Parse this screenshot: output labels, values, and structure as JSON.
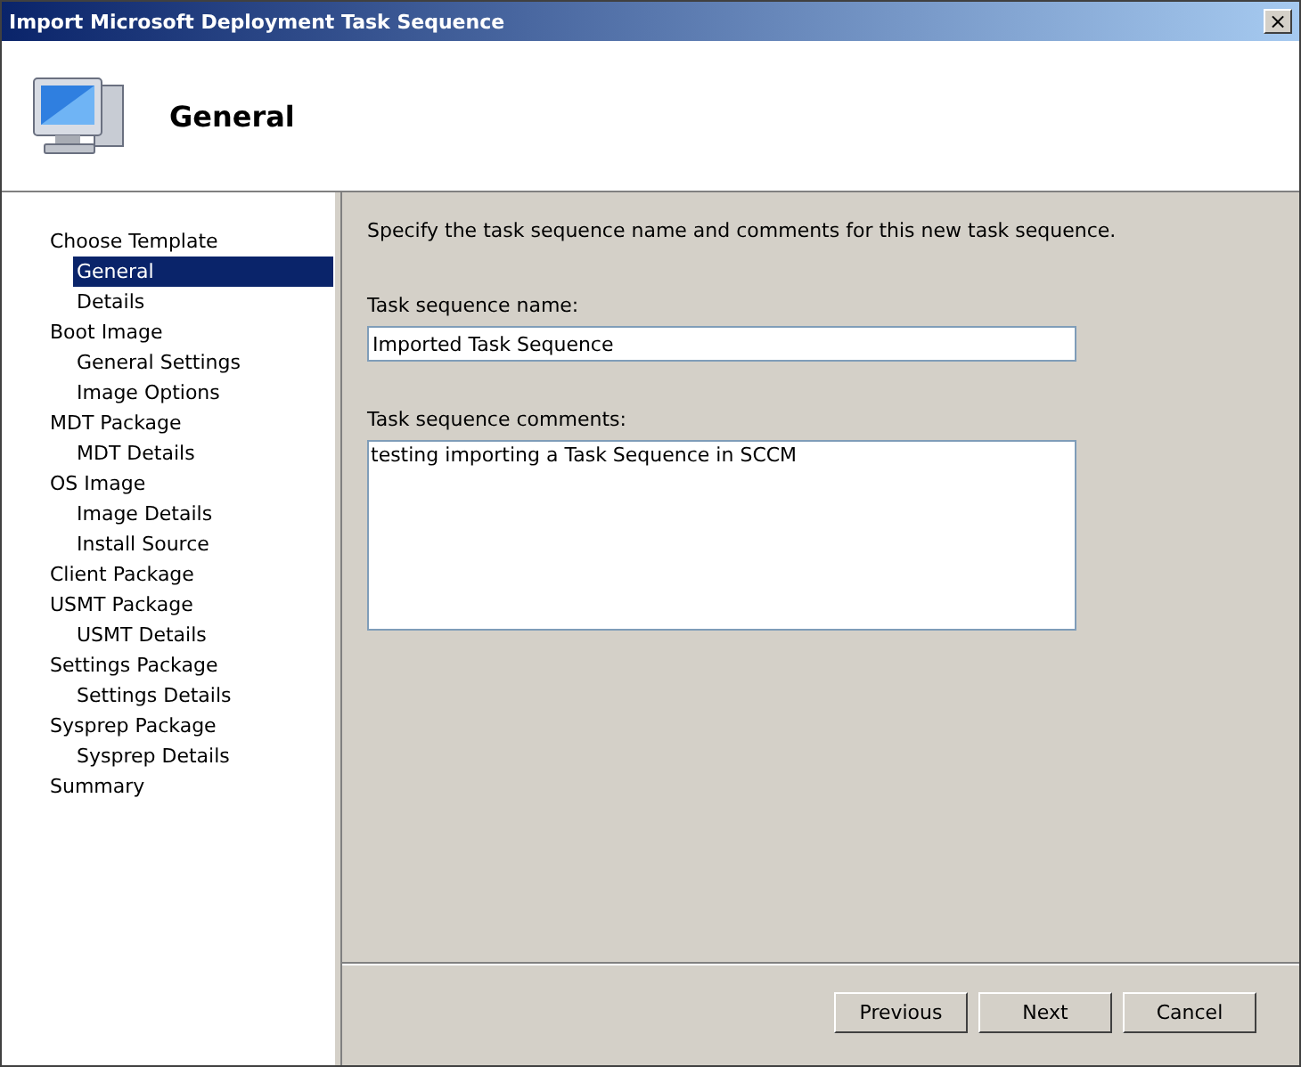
{
  "window": {
    "title": "Import Microsoft Deployment Task Sequence",
    "close": "×"
  },
  "header": {
    "title": "General"
  },
  "sidebar": {
    "items": [
      {
        "label": "Choose Template",
        "selected": false,
        "children": [
          {
            "label": "General",
            "selected": true
          },
          {
            "label": "Details",
            "selected": false
          }
        ]
      },
      {
        "label": "Boot Image",
        "selected": false,
        "children": [
          {
            "label": "General Settings",
            "selected": false
          },
          {
            "label": "Image Options",
            "selected": false
          }
        ]
      },
      {
        "label": "MDT Package",
        "selected": false,
        "children": [
          {
            "label": "MDT Details",
            "selected": false
          }
        ]
      },
      {
        "label": "OS Image",
        "selected": false,
        "children": [
          {
            "label": "Image Details",
            "selected": false
          },
          {
            "label": "Install Source",
            "selected": false
          }
        ]
      },
      {
        "label": "Client Package",
        "selected": false
      },
      {
        "label": "USMT Package",
        "selected": false,
        "children": [
          {
            "label": "USMT Details",
            "selected": false
          }
        ]
      },
      {
        "label": "Settings Package",
        "selected": false,
        "children": [
          {
            "label": "Settings Details",
            "selected": false
          }
        ]
      },
      {
        "label": "Sysprep Package",
        "selected": false,
        "children": [
          {
            "label": "Sysprep Details",
            "selected": false
          }
        ]
      },
      {
        "label": "Summary",
        "selected": false
      }
    ]
  },
  "content": {
    "intro": "Specify the task sequence name and comments for this new task sequence.",
    "name_label": "Task sequence name:",
    "name_value": "Imported Task Sequence",
    "comments_label": "Task sequence comments:",
    "comments_value": "testing importing a Task Sequence in SCCM"
  },
  "buttons": [
    {
      "label": "Previous"
    },
    {
      "label": "Next"
    },
    {
      "label": "Cancel"
    }
  ]
}
